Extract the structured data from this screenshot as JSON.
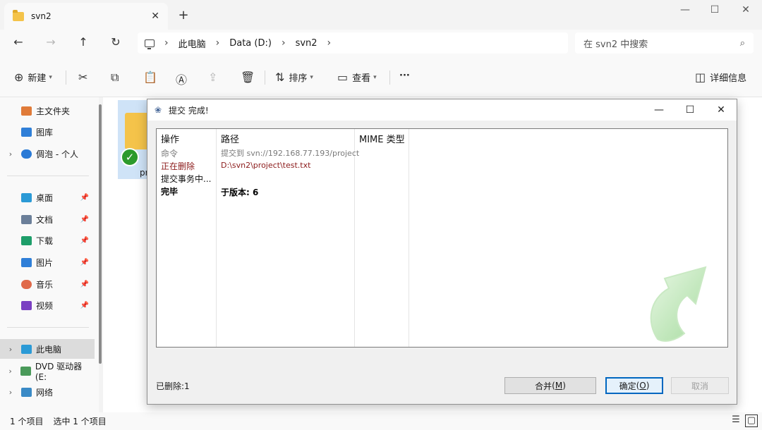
{
  "explorer": {
    "tab_title": "svn2",
    "tab_close": "✕",
    "new_tab": "+",
    "window_controls": {
      "minimize": "—",
      "maximize": "☐",
      "close": "✕"
    },
    "breadcrumb": [
      "此电脑",
      "Data (D:)",
      "svn2"
    ],
    "search_placeholder": "在 svn2 中搜索",
    "toolbar": {
      "new_label": "新建",
      "sort_label": "排序",
      "view_label": "查看",
      "more_label": "···",
      "details_label": "详细信息"
    },
    "sidebar": [
      {
        "label": "主文件夹",
        "icon": "home-icon"
      },
      {
        "label": "图库",
        "icon": "gallery-icon"
      },
      {
        "label": "倜泡 - 个人",
        "icon": "cloud-icon"
      },
      {
        "label": "桌面",
        "icon": "desktop-icon"
      },
      {
        "label": "文档",
        "icon": "documents-icon"
      },
      {
        "label": "下载",
        "icon": "downloads-icon"
      },
      {
        "label": "图片",
        "icon": "pictures-icon"
      },
      {
        "label": "音乐",
        "icon": "music-icon"
      },
      {
        "label": "视频",
        "icon": "videos-icon"
      },
      {
        "label": "此电脑",
        "icon": "pc-icon"
      },
      {
        "label": "DVD 驱动器 (E:",
        "icon": "dvd-icon"
      },
      {
        "label": "网络",
        "icon": "network-icon"
      }
    ],
    "file_label": "pr",
    "status": {
      "count": "1 个项目",
      "selected": "选中 1 个项目"
    }
  },
  "dialog": {
    "title": "提交 完成!",
    "columns": [
      "操作",
      "路径",
      "MIME 类型"
    ],
    "rows": [
      {
        "action": "命令",
        "path": "提交到 svn://192.168.77.193/project",
        "style": "gray"
      },
      {
        "action": "正在删除",
        "path": "D:\\svn2\\project\\test.txt",
        "style": "red"
      },
      {
        "action": "提交事务中...",
        "path": "",
        "style": "black"
      },
      {
        "action": "完毕",
        "path": "于版本: 6",
        "style": "bold"
      }
    ],
    "status_text": "已删除:1",
    "buttons": {
      "merge": "合并",
      "merge_key": "M",
      "ok": "确定",
      "ok_key": "O",
      "cancel": "取消"
    }
  }
}
